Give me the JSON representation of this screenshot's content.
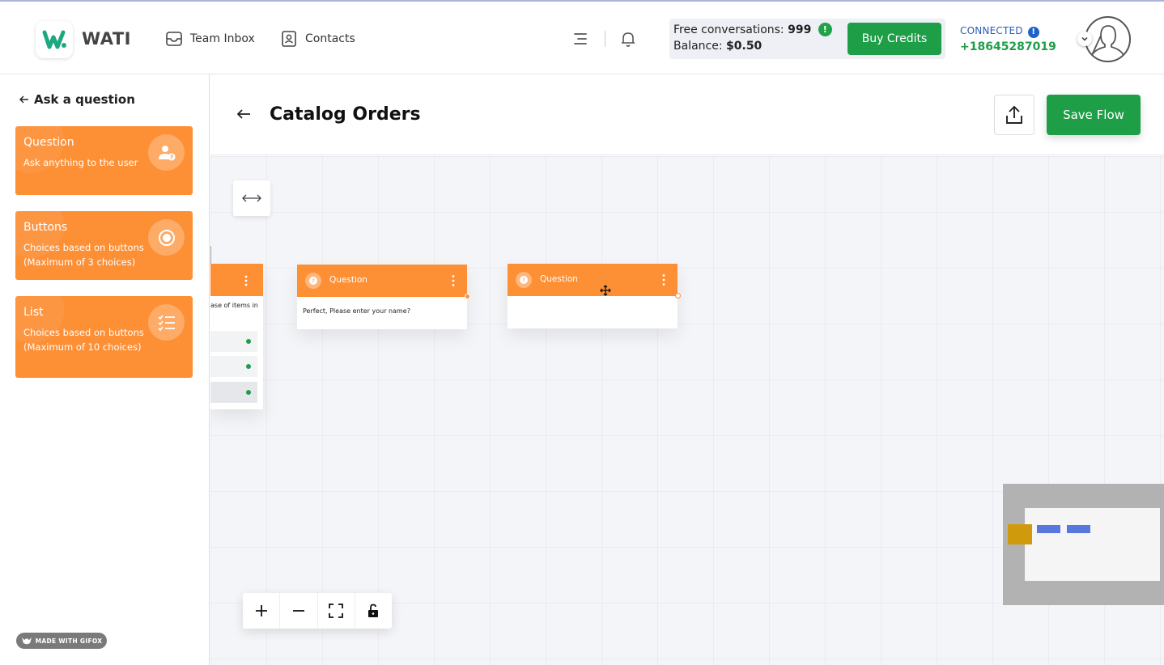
{
  "header": {
    "brand": "WATI",
    "nav": [
      {
        "label": "Team Inbox",
        "icon": "inbox-icon"
      },
      {
        "label": "Contacts",
        "icon": "contacts-icon"
      }
    ],
    "credits": {
      "free_label": "Free conversations:",
      "free_value": "999",
      "balance_label": "Balance:",
      "balance_value": "$0.50",
      "warn_glyph": "!"
    },
    "buy_label": "Buy Credits",
    "status": "CONNECTED",
    "info_glyph": "!",
    "phone": "+18645287019"
  },
  "sidebar": {
    "back_label": "Ask a question",
    "blocks": [
      {
        "title": "Question",
        "desc": "Ask anything to the user",
        "icon": "user-question-icon"
      },
      {
        "title": "Buttons",
        "desc": "Choices based on buttons (Maximum of 3 choices)",
        "icon": "radio-icon"
      },
      {
        "title": "List",
        "desc": "Choices based on buttons (Maximum of 10 choices)",
        "icon": "checklist-icon"
      }
    ],
    "watermark": "MADE WITH GIFOX"
  },
  "flow": {
    "title": "Catalog Orders",
    "save_label": "Save Flow"
  },
  "canvas": {
    "partial_node_text": "ase of items in",
    "nodes": [
      {
        "title": "Question",
        "text": "Perfect, Please enter your name?"
      },
      {
        "title": "Question",
        "text": ""
      }
    ]
  },
  "colors": {
    "accent_orange": "#fd8f35",
    "brand_green": "#1e9e47",
    "link_blue": "#2a5bb8"
  }
}
